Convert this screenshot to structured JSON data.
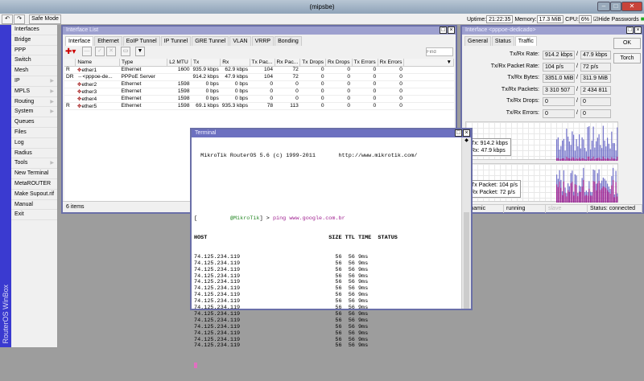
{
  "window": {
    "title": "(mipsbe)"
  },
  "toolbar": {
    "undo": "undo-icon",
    "redo": "redo-icon",
    "safe_mode": "Safe Mode",
    "uptime_label": "Uptime:",
    "uptime": "21:22:35",
    "memory_label": "Memory:",
    "memory": "17.3 MiB",
    "cpu_label": "CPU:",
    "cpu": "6%",
    "hide_passwords": "Hide Passwords"
  },
  "sidebar": {
    "brand": "RouterOS WinBox",
    "items": [
      {
        "label": "Interfaces"
      },
      {
        "label": "Bridge"
      },
      {
        "label": "PPP"
      },
      {
        "label": "Switch"
      },
      {
        "label": "Mesh"
      },
      {
        "label": "IP",
        "sub": true
      },
      {
        "label": "MPLS",
        "sub": true
      },
      {
        "label": "Routing",
        "sub": true
      },
      {
        "label": "System",
        "sub": true
      },
      {
        "label": "Queues"
      },
      {
        "label": "Files"
      },
      {
        "label": "Log"
      },
      {
        "label": "Radius"
      },
      {
        "label": "Tools",
        "sub": true
      },
      {
        "label": "New Terminal"
      },
      {
        "label": "MetaROUTER"
      },
      {
        "label": "Make Supout.rif"
      },
      {
        "label": "Manual"
      },
      {
        "label": "Exit"
      }
    ]
  },
  "iflist": {
    "title": "Interface List",
    "tabs": [
      "Interface",
      "Ethernet",
      "EoIP Tunnel",
      "IP Tunnel",
      "GRE Tunnel",
      "VLAN",
      "VRRP",
      "Bonding"
    ],
    "find_placeholder": "Find",
    "columns": [
      "",
      "Name",
      "Type",
      "L2 MTU",
      "Tx",
      "Rx",
      "Tx Pac...",
      "Rx Pac...",
      "Tx Drops",
      "Rx Drops",
      "Tx Errors",
      "Rx Errors"
    ],
    "rows": [
      [
        "R",
        "ether1",
        "Ethernet",
        "1600",
        "935.9 kbps",
        "62.9 kbps",
        "104",
        "72",
        "0",
        "0",
        "0",
        "0"
      ],
      [
        "DR",
        "<pppoe-de...",
        "PPPoE Server",
        "",
        "914.2 kbps",
        "47.9 kbps",
        "104",
        "72",
        "0",
        "0",
        "0",
        "0"
      ],
      [
        "",
        "ether2",
        "Ethernet",
        "1598",
        "0 bps",
        "0 bps",
        "0",
        "0",
        "0",
        "0",
        "0",
        "0"
      ],
      [
        "",
        "ether3",
        "Ethernet",
        "1598",
        "0 bps",
        "0 bps",
        "0",
        "0",
        "0",
        "0",
        "0",
        "0"
      ],
      [
        "",
        "ether4",
        "Ethernet",
        "1598",
        "0 bps",
        "0 bps",
        "0",
        "0",
        "0",
        "0",
        "0",
        "0"
      ],
      [
        "R",
        "ether5",
        "Ethernet",
        "1598",
        "69.1 kbps",
        "935.3 kbps",
        "78",
        "113",
        "0",
        "0",
        "0",
        "0"
      ]
    ],
    "footer": "6 items"
  },
  "ifwin": {
    "title": "Interface <pppoe-dedicado>",
    "tabs": [
      "General",
      "Status",
      "Traffic"
    ],
    "ok": "OK",
    "torch": "Torch",
    "fields": [
      {
        "label": "Tx/Rx Rate:",
        "tx": "914.2 kbps",
        "rx": "47.9 kbps"
      },
      {
        "label": "Tx/Rx Packet Rate:",
        "tx": "104 p/s",
        "rx": "72 p/s"
      },
      {
        "label": "Tx/Rx Bytes:",
        "tx": "3351.0 MiB",
        "rx": "311.9 MiB"
      },
      {
        "label": "Tx/Rx Packets:",
        "tx": "3 310 507",
        "rx": "2 434 811"
      },
      {
        "label": "Tx/Rx Drops:",
        "tx": "0",
        "rx": "0"
      },
      {
        "label": "Tx/Rx Errors:",
        "tx": "0",
        "rx": "0"
      }
    ],
    "graph1": {
      "tx": "Tx:  914.2 kbps",
      "rx": "Rx:  47.9 kbps"
    },
    "graph2": {
      "tx": "Tx Packet:  104 p/s",
      "rx": "Rx Packet:  72 p/s"
    },
    "status": [
      "dynamic",
      "running",
      "slave",
      "Status: connected"
    ]
  },
  "terminal": {
    "title": "Terminal",
    "banner": "  MikroTik RouterOS 5.6 (c) 1999-2011       http://www.mikrotik.com/",
    "prompt_open": "[",
    "prompt_host": "@MikroTik",
    "prompt_close": "] > ",
    "command": "ping www.google.com.br",
    "header": "HOST                                     SIZE TTL TIME  STATUS",
    "ping_line": "74.125.234.119                             56  56 9ms",
    "ping_count": 15
  },
  "colors": {
    "accent": "#6a6fa8",
    "tx": "#7070c8",
    "rx": "#a02090"
  }
}
